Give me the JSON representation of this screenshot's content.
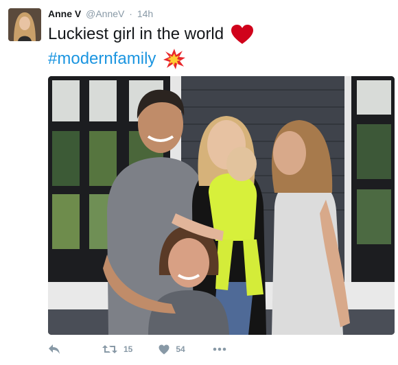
{
  "tweet": {
    "author_name": "Anne V",
    "author_handle": "@AnneV",
    "separator": "·",
    "timestamp": "14h",
    "text_line1": "Luckiest girl in the world",
    "hashtag": "#modernfamily",
    "retweet_count": "15",
    "like_count": "54"
  },
  "icons": {
    "reply": "reply-icon",
    "retweet": "retweet-icon",
    "like": "heart-icon",
    "more": "more-icon",
    "heart_emoji": "red-heart-emoji",
    "collision_emoji": "collision-emoji"
  },
  "colors": {
    "hashtag": "#1b95e0",
    "meta": "#8899a6",
    "heart": "#d0021b"
  }
}
